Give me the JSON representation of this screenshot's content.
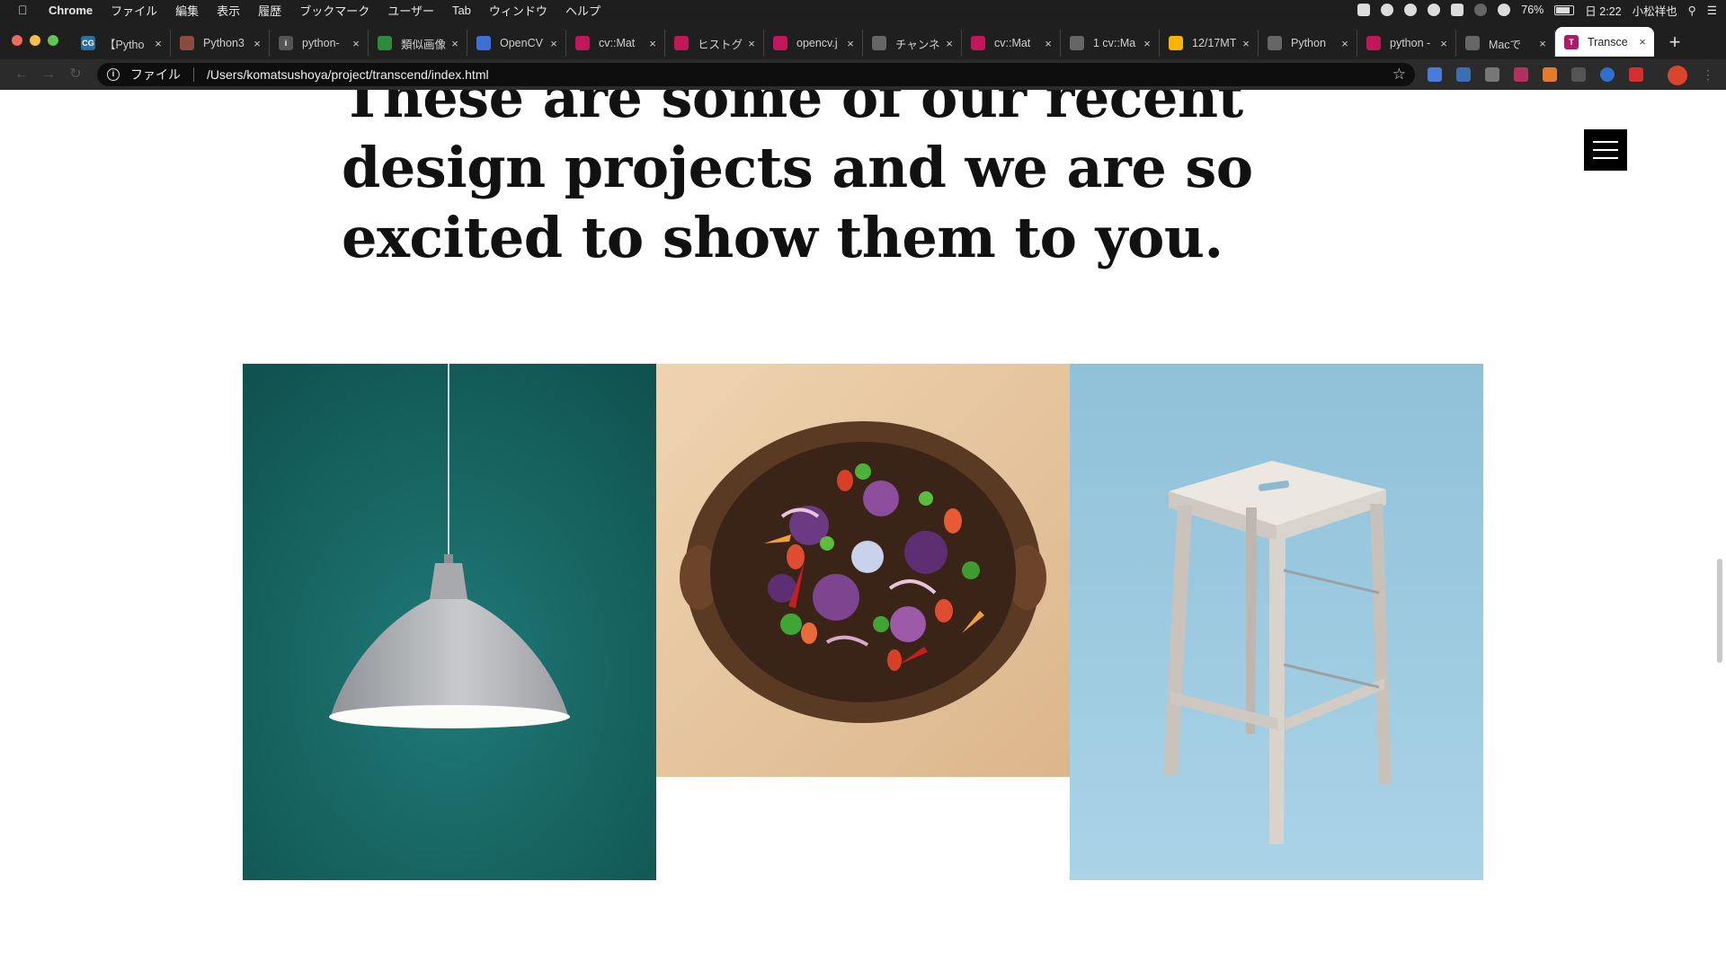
{
  "menubar": {
    "app": "Chrome",
    "items": [
      "ファイル",
      "編集",
      "表示",
      "履歴",
      "ブックマーク",
      "ユーザー",
      "Tab",
      "ウィンドウ",
      "ヘルプ"
    ],
    "battery": "76%",
    "clock": "日 2:22",
    "user": "小松祥也"
  },
  "tabs": [
    {
      "label": "【Pytho",
      "fav_color": "#2c6e9f",
      "fav_text": "CG"
    },
    {
      "label": "Python3",
      "fav_color": "#8a4b3a",
      "fav_text": ""
    },
    {
      "label": "python-",
      "fav_color": "#555555",
      "fav_text": "i"
    },
    {
      "label": "類似画像",
      "fav_color": "#2e8b3a",
      "fav_text": ""
    },
    {
      "label": "OpenCV",
      "fav_color": "#3d6fd9",
      "fav_text": ""
    },
    {
      "label": "cv::Mat",
      "fav_color": "#c2185b",
      "fav_text": ""
    },
    {
      "label": "ヒストグ",
      "fav_color": "#c2185b",
      "fav_text": ""
    },
    {
      "label": "opencv.j",
      "fav_color": "#c2185b",
      "fav_text": ""
    },
    {
      "label": "チャンネ",
      "fav_color": "#666666",
      "fav_text": ""
    },
    {
      "label": "cv::Mat",
      "fav_color": "#c2185b",
      "fav_text": ""
    },
    {
      "label": "1 cv::Ma",
      "fav_color": "#666666",
      "fav_text": ""
    },
    {
      "label": "12/17MT",
      "fav_color": "#f4b400",
      "fav_text": ""
    },
    {
      "label": "Python",
      "fav_color": "#666666",
      "fav_text": ""
    },
    {
      "label": "python -",
      "fav_color": "#c2185b",
      "fav_text": ""
    },
    {
      "label": "Macで",
      "fav_color": "#666666",
      "fav_text": ""
    },
    {
      "label": "Transce",
      "fav_color": "#b0186a",
      "fav_text": "T",
      "active": true
    }
  ],
  "address": {
    "scheme_label": "ファイル",
    "url": "/Users/komatsushoya/project/transcend/index.html"
  },
  "page": {
    "heading": "These are some of our recent design projects and we are so excited to show them to you."
  },
  "gallery": {
    "images": [
      {
        "subject": "pendant lamp",
        "bg": "#1c6d6b"
      },
      {
        "subject": "vegetable salad bowl",
        "bg": "#e8c9a3"
      },
      {
        "subject": "wooden stool",
        "bg": "#9ecbe0"
      }
    ]
  }
}
